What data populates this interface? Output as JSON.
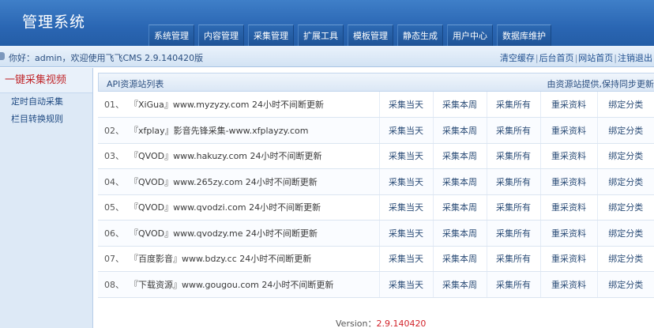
{
  "app": {
    "title": "管理系统"
  },
  "nav": [
    "系统管理",
    "内容管理",
    "采集管理",
    "扩展工具",
    "模板管理",
    "静态生成",
    "用户中心",
    "数据库维护"
  ],
  "infobar": {
    "welcome": "你好：admin，欢迎使用飞飞CMS 2.9.140420版",
    "links": [
      "清空缓存",
      "后台首页",
      "网站首页",
      "注销退出"
    ]
  },
  "sidebar": {
    "items": [
      "一键采集视频",
      "定时自动采集",
      "栏目转换规则"
    ]
  },
  "panel": {
    "title": "API资源站列表",
    "note": "由资源站提供,保持同步更新"
  },
  "actions": [
    "采集当天",
    "采集本周",
    "采集所有",
    "重采资料",
    "绑定分类"
  ],
  "sites": [
    {
      "num": "01、",
      "name": "『XiGua』www.myzyzy.com 24小时不间断更新"
    },
    {
      "num": "02、",
      "name": "『xfplay』影音先锋采集-www.xfplayzy.com"
    },
    {
      "num": "03、",
      "name": "『QVOD』www.hakuzy.com 24小时不间断更新"
    },
    {
      "num": "04、",
      "name": "『QVOD』www.265zy.com 24小时不间断更新"
    },
    {
      "num": "05、",
      "name": "『QVOD』www.qvodzi.com 24小时不间断更新"
    },
    {
      "num": "06、",
      "name": "『QVOD』www.qvodzy.me 24小时不间断更新"
    },
    {
      "num": "07、",
      "name": "『百度影音』www.bdzy.cc 24小时不间断更新"
    },
    {
      "num": "08、",
      "name": "『下载资源』www.gougou.com 24小时不间断更新"
    }
  ],
  "footer": {
    "version_label": "Version：",
    "version": "2.9.140420"
  }
}
